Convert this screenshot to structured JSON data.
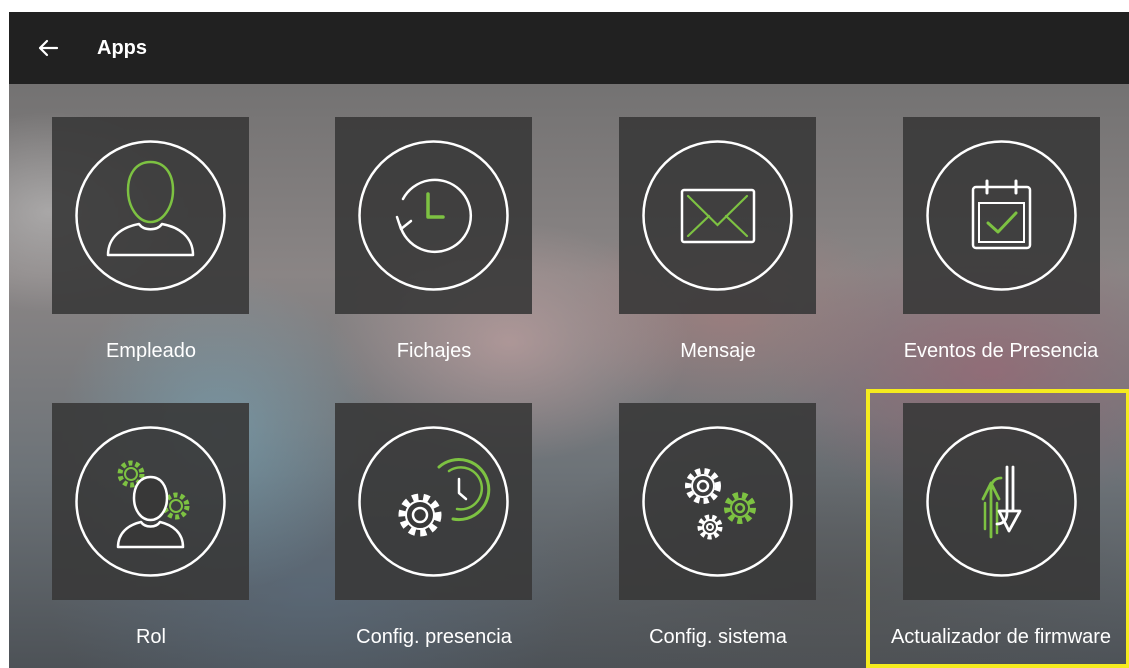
{
  "header": {
    "title": "Apps",
    "back_icon": "arrow-left-icon"
  },
  "apps": [
    {
      "label": "Empleado",
      "icon": "user-icon"
    },
    {
      "label": "Fichajes",
      "icon": "history-clock-icon"
    },
    {
      "label": "Mensaje",
      "icon": "envelope-icon"
    },
    {
      "label": "Eventos de Presencia",
      "icon": "calendar-check-icon"
    },
    {
      "label": "Rol",
      "icon": "user-gears-icon"
    },
    {
      "label": "Config. presencia",
      "icon": "gear-clock-icon"
    },
    {
      "label": "Config. sistema",
      "icon": "gears-icon"
    },
    {
      "label": "Actualizador de firmware",
      "icon": "up-down-arrows-icon"
    }
  ],
  "colors": {
    "accent": "#7dc242",
    "highlight": "#f5eb1e",
    "topbar": "#212121",
    "tile": "#383838"
  },
  "selected_app": "Actualizador de firmware"
}
